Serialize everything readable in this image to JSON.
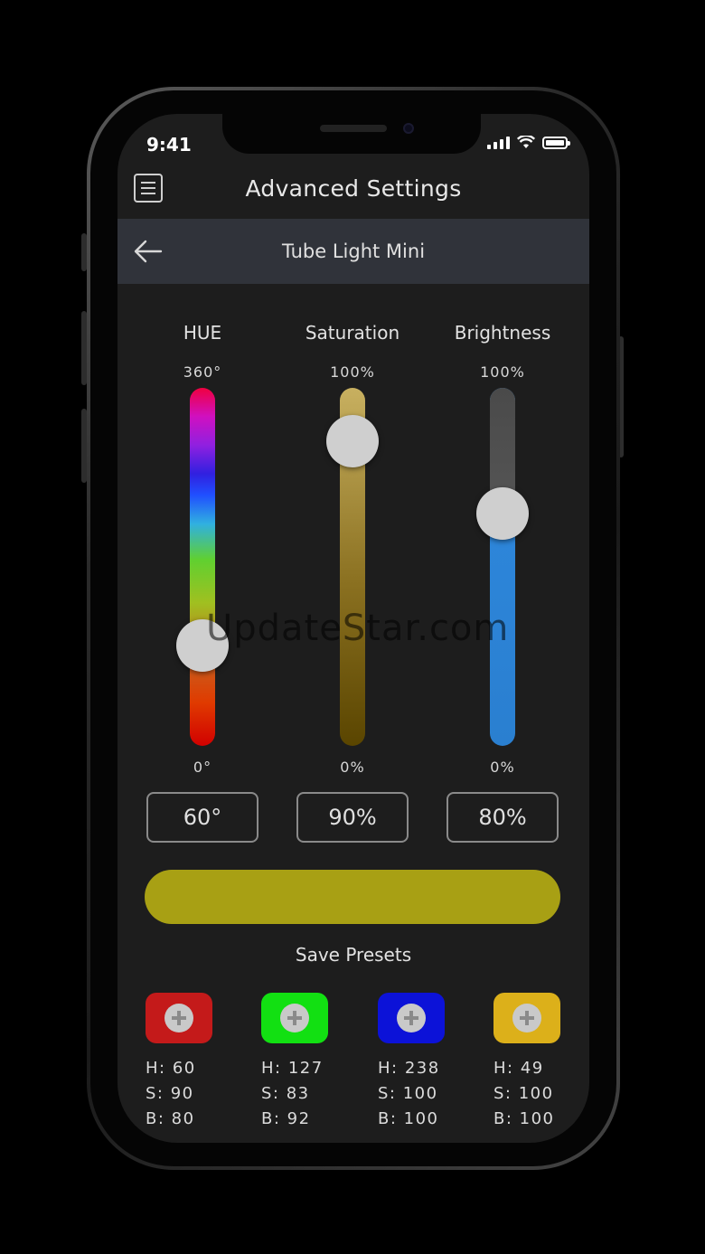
{
  "status_bar": {
    "time": "9:41"
  },
  "header": {
    "title": "Advanced Settings"
  },
  "subheader": {
    "device_name": "Tube Light Mini"
  },
  "sliders": [
    {
      "label": "HUE",
      "max_label": "360°",
      "min_label": "0°",
      "value_label": "60°",
      "fraction": 0.72
    },
    {
      "label": "Saturation",
      "max_label": "100%",
      "min_label": "0%",
      "value_label": "90%",
      "fraction": 0.15
    },
    {
      "label": "Brightness",
      "max_label": "100%",
      "min_label": "0%",
      "value_label": "80%",
      "fraction": 0.35
    }
  ],
  "preview_color": "#a8a014",
  "presets_title": "Save Presets",
  "presets": [
    {
      "color": "#c41a1a",
      "h": "H: 60",
      "s": "S: 90",
      "b": "B: 80"
    },
    {
      "color": "#12e012",
      "h": "H: 127",
      "s": "S: 83",
      "b": "B: 92"
    },
    {
      "color": "#0c12d8",
      "h": "H: 238",
      "s": "S: 100",
      "b": "B: 100"
    },
    {
      "color": "#dcb01a",
      "h": "H: 49",
      "s": "S: 100",
      "b": "B: 100"
    }
  ],
  "watermark": "UpdateStar.com"
}
